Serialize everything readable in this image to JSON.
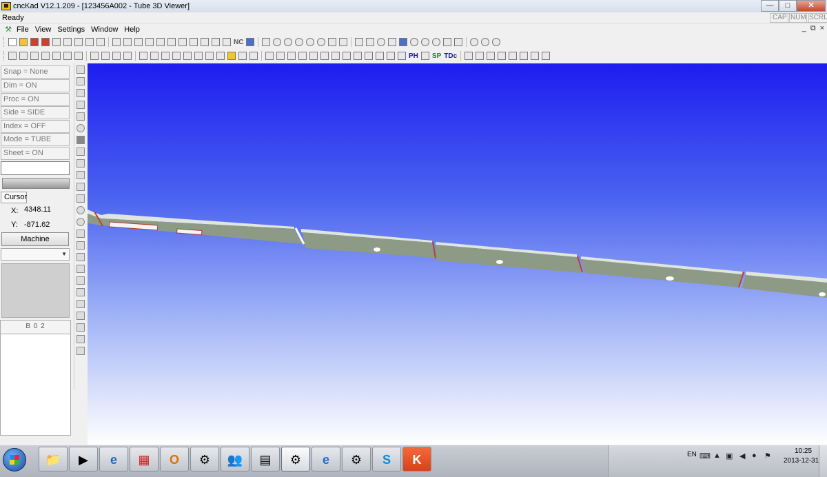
{
  "window": {
    "title": "cncKad V12.1.209 - [123456A002 - Tube 3D Viewer]",
    "controls": {
      "minimize": "—",
      "maximize": "□",
      "close": "✕"
    }
  },
  "status": {
    "ready": "Ready",
    "indicators": [
      "CAP",
      "NUM",
      "SCRL"
    ]
  },
  "menu": {
    "items": [
      "File",
      "View",
      "Settings",
      "Window",
      "Help"
    ],
    "mdi": {
      "minimize": "_",
      "restore": "⧉",
      "close": "×"
    }
  },
  "toolbar": {
    "nc_label": "NC",
    "ph_label": "PH",
    "sp_label": "SP",
    "tdc_label": "TDc"
  },
  "left_panel": {
    "settings": [
      "Snap = None",
      "Dim = ON",
      "Proc = ON",
      "Side = SIDE",
      "Index = OFF",
      "Mode = TUBE",
      "Sheet = ON"
    ],
    "cursor_label": "Cursor",
    "x_label": "X:",
    "x_value": "4348.11",
    "y_label": "Y:",
    "y_value": "-871.62",
    "machine_button": "Machine",
    "panel_header": "B 0 2"
  },
  "viewport": {
    "sky_top_color": "#1d1df0",
    "tube_color": "#8d9a86",
    "tube_top_color": "#e0e6dd",
    "cut_color": "#c0402a"
  },
  "taskbar": {
    "apps": [
      {
        "name": "windows-explorer",
        "glyph": "📁"
      },
      {
        "name": "media-player",
        "glyph": "▶"
      },
      {
        "name": "internet-explorer",
        "glyph": "e"
      },
      {
        "name": "red-app",
        "glyph": "▦"
      },
      {
        "name": "outlook",
        "glyph": "O"
      },
      {
        "name": "cnckad",
        "glyph": "⚙"
      },
      {
        "name": "messenger",
        "glyph": "👥"
      },
      {
        "name": "calculator",
        "glyph": "▤"
      },
      {
        "name": "cnckad-2",
        "glyph": "⚙"
      },
      {
        "name": "internet-explorer-2",
        "glyph": "e"
      },
      {
        "name": "cnckad-v12",
        "glyph": "⚙"
      },
      {
        "name": "skype",
        "glyph": "S"
      },
      {
        "name": "kt-app",
        "glyph": "K"
      }
    ],
    "tray": {
      "lang": "EN",
      "time": "10:25",
      "date": "2013-12-31"
    }
  }
}
